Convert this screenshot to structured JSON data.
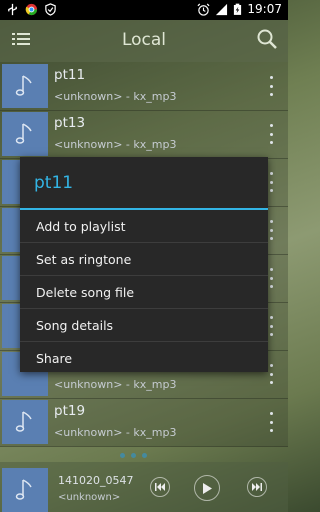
{
  "status_bar": {
    "time": "19:07",
    "left_icons": [
      "usb-icon",
      "chrome-icon",
      "shield-icon"
    ],
    "right_icons": [
      "alarm-icon",
      "signal-icon",
      "battery-charging-icon"
    ]
  },
  "action_bar": {
    "title": "Local",
    "menu_icon": "list-menu-icon",
    "search_icon": "search-icon"
  },
  "songs": [
    {
      "title": "pt11",
      "subtitle": "<unknown> - kx_mp3"
    },
    {
      "title": "pt13",
      "subtitle": "<unknown> - kx_mp3"
    },
    {
      "title": "",
      "subtitle": ""
    },
    {
      "title": "",
      "subtitle": ""
    },
    {
      "title": "",
      "subtitle": ""
    },
    {
      "title": "",
      "subtitle": ""
    },
    {
      "title": "",
      "subtitle": "<unknown> - kx_mp3"
    },
    {
      "title": "pt19",
      "subtitle": "<unknown> - kx_mp3"
    }
  ],
  "dialog": {
    "title": "pt11",
    "items": [
      "Add to playlist",
      "Set as ringtone",
      "Delete song file",
      "Song details",
      "Share"
    ]
  },
  "player": {
    "title": "141020_0547",
    "subtitle": "<unknown>"
  },
  "colors": {
    "accent": "#33b5e5",
    "thumb": "#5a7fb2",
    "dialog_bg": "#282828"
  }
}
